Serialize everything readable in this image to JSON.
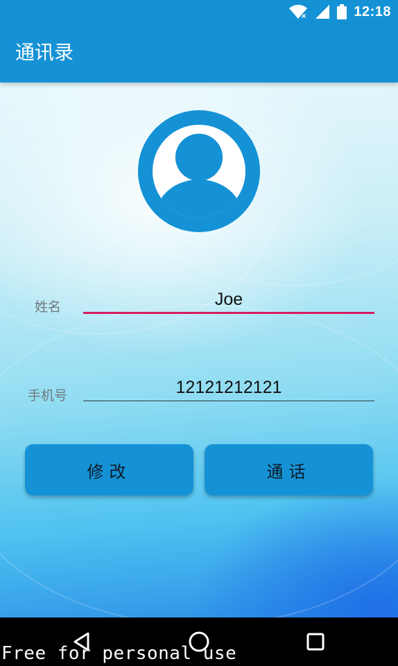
{
  "status_bar": {
    "time": "12:18",
    "icons": [
      "wifi-icon",
      "signal-icon",
      "battery-icon"
    ],
    "color": "#1592d5"
  },
  "app_bar": {
    "title": "通讯录",
    "color": "#1592d5"
  },
  "avatar": {
    "icon": "person-avatar-icon",
    "color": "#1592d5"
  },
  "form": {
    "name": {
      "label": "姓名",
      "value": "Joe",
      "underline_color": "#d81b60"
    },
    "phone": {
      "label": "手机号",
      "value": "12121212121",
      "underline_color": "#2b3a42"
    }
  },
  "buttons": {
    "edit_label": "修改",
    "call_label": "通话"
  },
  "nav_bar": {
    "icons": [
      "back-icon",
      "home-icon",
      "recents-icon"
    ]
  },
  "watermark": "Free for personal use"
}
